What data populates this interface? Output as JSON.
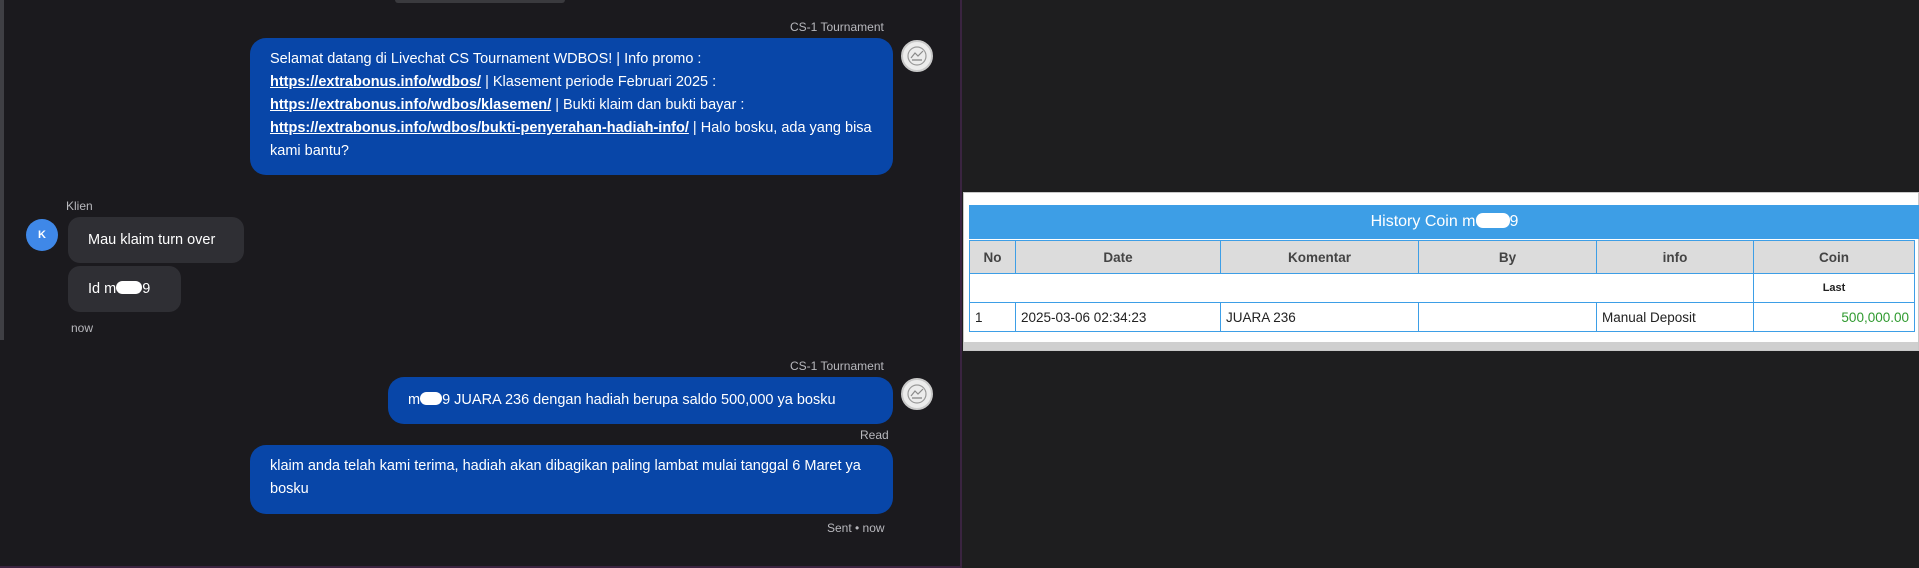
{
  "chat": {
    "messages": [
      {
        "sender": "CS-1 Tournament",
        "parts": [
          "Selamat datang di Livechat CS Tournament WDBOS! | Info promo :",
          "https://extrabonus.info/wdbos/",
          " | Klasement periode Februari 2025 :",
          "https://extrabonus.info/wdbos/klasemen/",
          " | Bukti klaim dan bukti bayar :",
          "https://extrabonus.info/wdbos/bukti-penyerahan-hadiah-info/",
          " | Halo bosku, ada yang bisa kami bantu?"
        ]
      },
      {
        "sender": "Klien",
        "avatar_letter": "K",
        "bubble1": "Mau klaim turn over",
        "bubble2_prefix": "Id m",
        "bubble2_suffix": "9",
        "time": "now"
      },
      {
        "sender": "CS-1 Tournament",
        "text_prefix": "m",
        "text_suffix": "9 JUARA 236 dengan hadiah berupa saldo 500,000 ya bosku",
        "status": "Read"
      },
      {
        "text": "klaim anda telah kami terima, hadiah akan dibagikan paling lambat mulai tanggal 6 Maret ya bosku",
        "status": "Sent • now"
      }
    ]
  },
  "history": {
    "title_prefix": "History Coin m",
    "title_suffix": "9",
    "columns": [
      "No",
      "Date",
      "Komentar",
      "By",
      "info",
      "Coin"
    ],
    "sub_label": "Last",
    "rows": [
      {
        "no": "1",
        "date": "2025-03-06 02:34:23",
        "komentar": "JUARA 236",
        "by": "",
        "info": "Manual Deposit",
        "coin": "500,000.00"
      }
    ]
  },
  "colors": {
    "bubble_out": "#0846a8",
    "bubble_in": "#2f2f34",
    "table_header": "#3d9ee6",
    "coin_value": "#2f9a2f"
  }
}
